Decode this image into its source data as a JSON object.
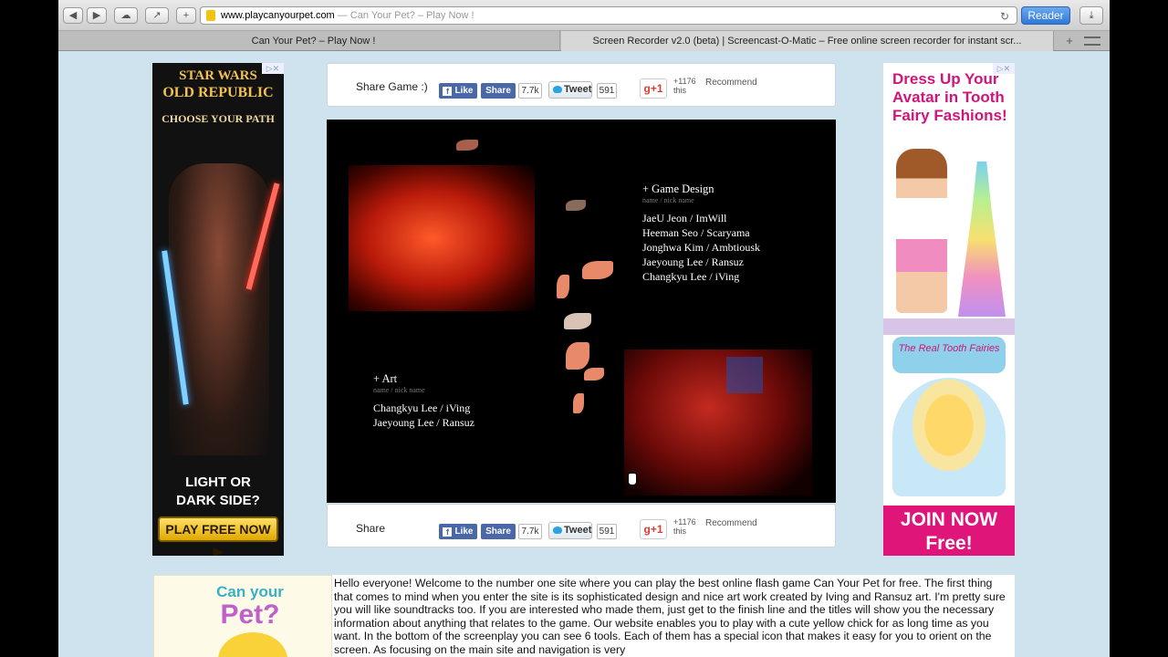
{
  "browser": {
    "back_label": "◀",
    "forward_label": "▶",
    "cloud_label": "☁",
    "share_label": "↗",
    "add_label": "+",
    "url": "www.playcanyourpet.com",
    "url_separator": " — ",
    "page_title_in_addr": "Can Your Pet? – Play Now !",
    "reload_label": "↻",
    "reader_label": "Reader",
    "download_label": "⤓",
    "new_tab_label": "+"
  },
  "tabs": [
    {
      "label": "Can Your Pet? – Play Now !"
    },
    {
      "label": "Screen Recorder v2.0 (beta) | Screencast-O-Matic – Free online screen recorder for instant scr..."
    }
  ],
  "left_ad": {
    "title_line1": "STAR WARS",
    "title_line2": "OLD REPUBLIC",
    "tagline": "CHOOSE YOUR PATH",
    "light_line1": "LIGHT OR",
    "light_line2": "DARK SIDE?",
    "cta": "PLAY FREE NOW ▶",
    "close": "▷✕"
  },
  "right_ad": {
    "headline": "Dress Up Your Avatar in Tooth Fairy Fashions!",
    "logo": "The Real Tooth Fairies",
    "join_line1": "JOIN NOW",
    "join_line2": "Free!",
    "close": "▷✕"
  },
  "share_top": {
    "label": "Share Game :)",
    "like": "Like",
    "share": "Share",
    "fb_count": "7.7k",
    "tweet": "Tweet",
    "tweet_count": "591",
    "gplus": "g+1",
    "gplus_count": "+1176 this",
    "recommend": "Recommend"
  },
  "share_bottom": {
    "label": "Share",
    "like": "Like",
    "share": "Share",
    "fb_count": "7.7k",
    "tweet": "Tweet",
    "tweet_count": "591",
    "gplus": "g+1",
    "gplus_count": "+1176 this",
    "recommend": "Recommend"
  },
  "game": {
    "design_header": "+ Game Design",
    "design_sub": "name / nick name",
    "design_credits": [
      "JaeU Jeon / ImWill",
      "Heeman Seo / Scaryama",
      "Jonghwa Kim / Ambtiousk",
      "Jaeyoung Lee / Ransuz",
      "Changkyu Lee / iVing"
    ],
    "art_header": "+ Art",
    "art_sub": "name / nick name",
    "art_credits": [
      "Changkyu Lee / iVing",
      "Jaeyoung Lee / Ransuz"
    ]
  },
  "thumb": {
    "line1": "Can your",
    "line2": "Pet?"
  },
  "description": "Hello everyone! Welcome to the number one site where you can play the best online flash game Can Your Pet for free. The first thing that comes to mind when you enter the site is its sophisticated design and nice art work created by Iving and Ransuz art. I'm pretty sure you will like soundtracks too. If you are interested who made them, just get to the finish line and the titles will show you the necessary information about anything that relates to the game. Our website enables you to play with a cute yellow chick for as long time as you want. In the bottom of the screenplay you can see 6 tools. Each of them has a special icon that makes it easy for you to orient on the screen. As focusing on the main site and navigation is very"
}
